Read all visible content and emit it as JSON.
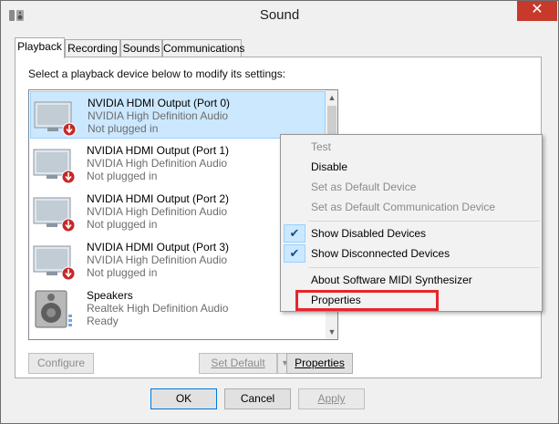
{
  "window": {
    "title": "Sound",
    "close_glyph": "✕"
  },
  "tabs": [
    {
      "label": "Playback"
    },
    {
      "label": "Recording"
    },
    {
      "label": "Sounds"
    },
    {
      "label": "Communications"
    }
  ],
  "instruction": "Select a playback device below to modify its settings:",
  "devices": [
    {
      "name": "NVIDIA HDMI Output (Port 0)",
      "driver": "NVIDIA High Definition Audio",
      "status": "Not plugged in",
      "icon": "monitor-icon"
    },
    {
      "name": "NVIDIA HDMI Output (Port 1)",
      "driver": "NVIDIA High Definition Audio",
      "status": "Not plugged in",
      "icon": "monitor-icon"
    },
    {
      "name": "NVIDIA HDMI Output (Port 2)",
      "driver": "NVIDIA High Definition Audio",
      "status": "Not plugged in",
      "icon": "monitor-icon"
    },
    {
      "name": "NVIDIA HDMI Output (Port 3)",
      "driver": "NVIDIA High Definition Audio",
      "status": "Not plugged in",
      "icon": "monitor-icon"
    },
    {
      "name": "Speakers",
      "driver": "Realtek High Definition Audio",
      "status": "Ready",
      "icon": "speaker-icon"
    }
  ],
  "buttons": {
    "configure": "Configure",
    "set_default": "Set Default",
    "properties": "Properties",
    "ok": "OK",
    "cancel": "Cancel",
    "apply": "Apply"
  },
  "context_menu": {
    "items": [
      {
        "label": "Test",
        "enabled": false
      },
      {
        "label": "Disable",
        "enabled": true
      },
      {
        "label": "Set as Default Device",
        "enabled": false
      },
      {
        "label": "Set as Default Communication Device",
        "enabled": false
      },
      {
        "label": "Show Disabled Devices",
        "enabled": true,
        "checked": true
      },
      {
        "label": "Show Disconnected Devices",
        "enabled": true,
        "checked": true
      },
      {
        "label": "About Software MIDI Synthesizer",
        "enabled": true
      },
      {
        "label": "Properties",
        "enabled": true
      }
    ],
    "check_glyph": "✔",
    "highlight_color": "#e8242b"
  },
  "colors": {
    "selection": "#cce8ff",
    "close_button": "#c7392b",
    "unplugged_badge": "#c62828"
  }
}
